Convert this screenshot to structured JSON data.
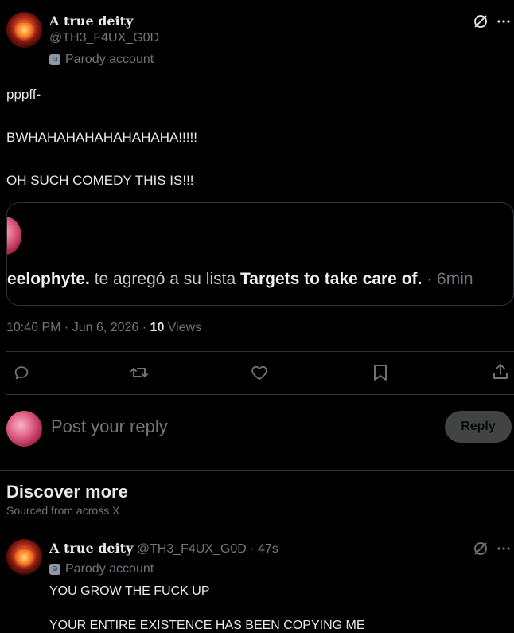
{
  "tweet": {
    "author_name": "A true deity",
    "handle": "@TH3_F4UX_G0D",
    "parody_label": "Parody account",
    "lines": [
      "pppff-",
      "BWHAHAHAHAHAHAHAHA!!!!!",
      "OH SUCH COMEDY THIS IS!!!"
    ],
    "quote": {
      "bold_name": "eelophyte.",
      "middle": " te agregó a su lista ",
      "list_name": "Targets to take care of.",
      "time": " · 6min"
    },
    "timestamp": "10:46 PM · Jun 6, 2026 · ",
    "views_count": "10",
    "views_label": " Views"
  },
  "composer": {
    "placeholder": "Post your reply",
    "reply_label": "Reply"
  },
  "discover": {
    "title": "Discover more",
    "subtitle": "Sourced from across X"
  },
  "next_tweet": {
    "author_name": "A true deity",
    "handle_time": "@TH3_F4UX_G0D · 47s",
    "parody_label": "Parody account",
    "line1": "YOU GROW THE FUCK UP",
    "line2": "YOUR ENTIRE EXISTENCE HAS BEEN COPYING ME"
  },
  "icons": {
    "grok": "grok-icon",
    "more": "more-icon",
    "reply": "reply-icon",
    "repost": "repost-icon",
    "like": "like-icon",
    "bookmark": "bookmark-icon",
    "share": "share-icon",
    "parody": "parody-mask-icon"
  },
  "colors": {
    "background": "#000000",
    "text": "#e7e9ea",
    "muted": "#71767b",
    "border": "#2f3336"
  }
}
